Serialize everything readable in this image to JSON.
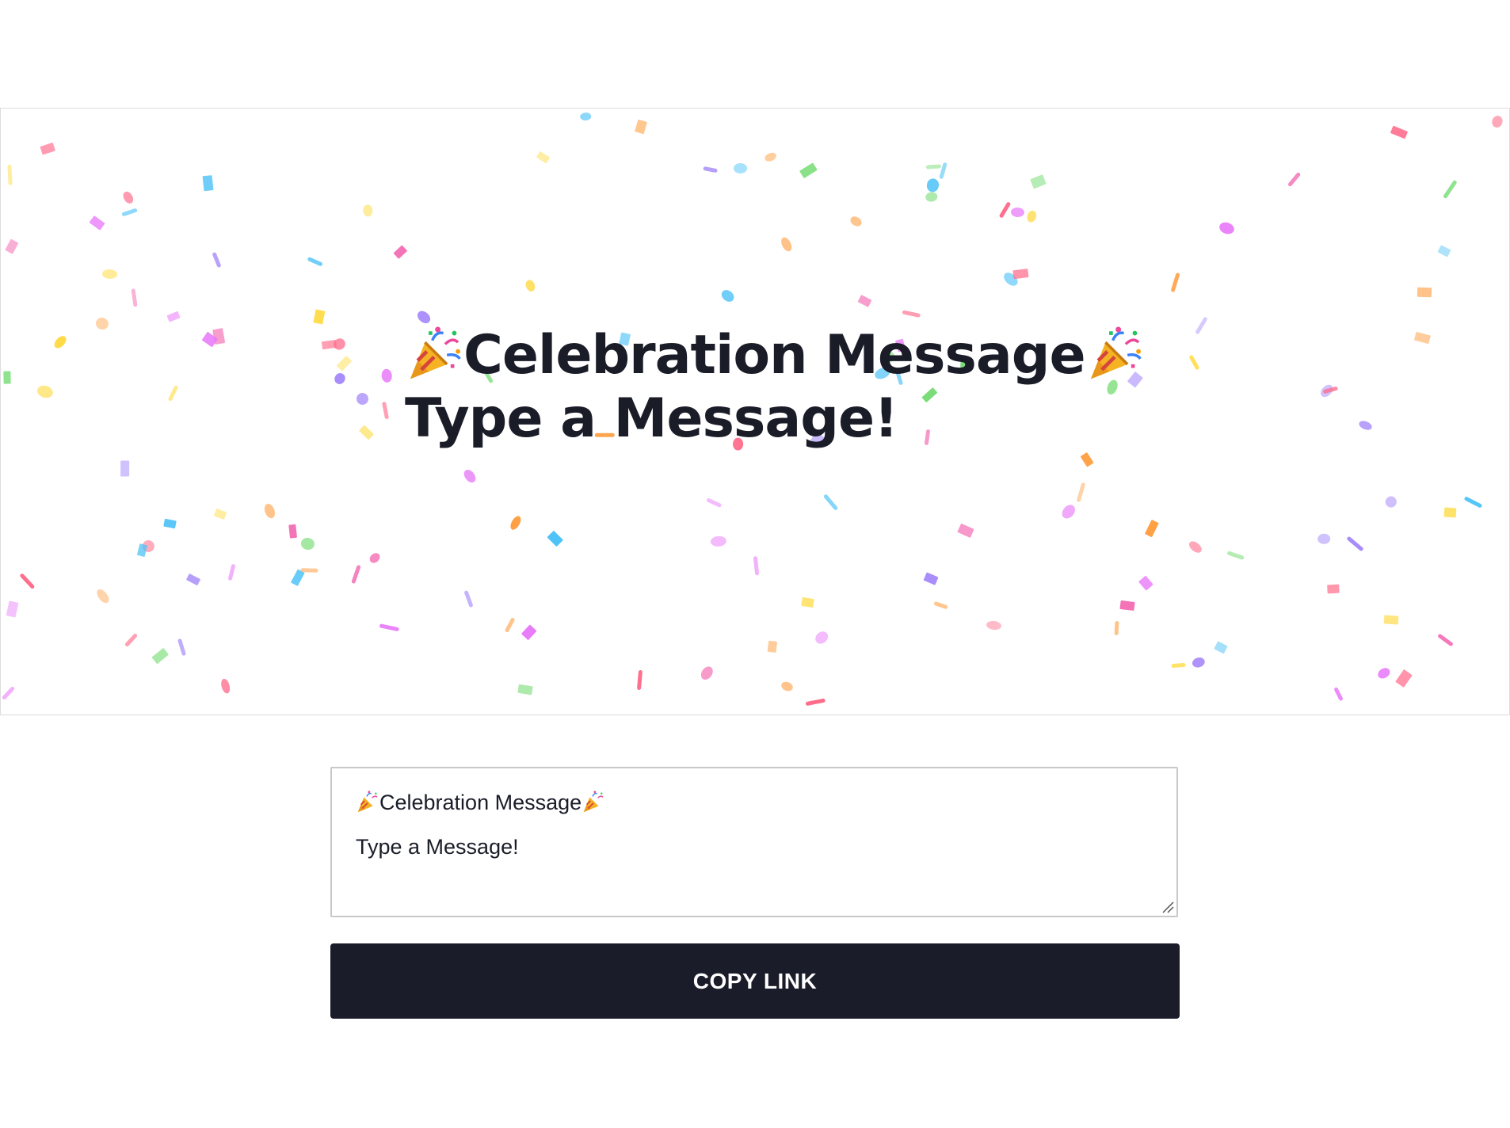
{
  "banner": {
    "title": "Celebration Message",
    "message": "Type a Message!",
    "decoration_icon": "party-popper-icon",
    "confetti_colors": [
      "#ff6b8a",
      "#ff9f43",
      "#ffd93d",
      "#6bd968",
      "#4fc3f7",
      "#a78bfa",
      "#f472b6",
      "#e879f9"
    ]
  },
  "editor": {
    "title_line": "Celebration Message",
    "message_line": "Type a Message!",
    "decoration_icon": "party-popper-icon"
  },
  "actions": {
    "copy_link_label": "COPY LINK"
  },
  "theme": {
    "button_background": "#1b1c29",
    "text_color": "#1a1c28"
  }
}
